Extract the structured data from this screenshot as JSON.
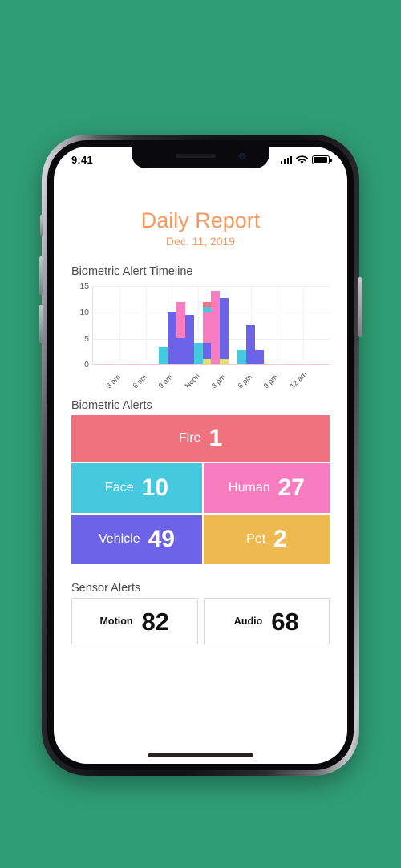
{
  "status_bar": {
    "time": "9:41",
    "signal_icon": "cellular-signal-icon",
    "wifi_icon": "wifi-icon",
    "battery_icon": "battery-icon"
  },
  "header": {
    "title": "Daily Report",
    "date": "Dec. 11, 2019",
    "accent_color": "#f5985e"
  },
  "timeline": {
    "label": "Biometric Alert Timeline"
  },
  "biometric": {
    "label": "Biometric Alerts",
    "tiles": [
      {
        "label": "Fire",
        "value": "1",
        "color": "#f0727f"
      },
      {
        "label": "Face",
        "value": "10",
        "color": "#46c8de"
      },
      {
        "label": "Human",
        "value": "27",
        "color": "#f77cc0"
      },
      {
        "label": "Vehicle",
        "value": "49",
        "color": "#6c63e8"
      },
      {
        "label": "Pet",
        "value": "2",
        "color": "#eeb94e"
      }
    ]
  },
  "sensor": {
    "label": "Sensor Alerts",
    "cards": [
      {
        "label": "Motion",
        "value": "82"
      },
      {
        "label": "Audio",
        "value": "68"
      }
    ]
  },
  "chart_data": {
    "type": "bar",
    "stacked": true,
    "title": "Biometric Alert Timeline",
    "xlabel": "",
    "ylabel": "",
    "ylim": [
      0,
      15
    ],
    "yticks": [
      0,
      5,
      10,
      15
    ],
    "grid": true,
    "legend": "none",
    "series_colors": {
      "Pet": "#e3dd6e",
      "Vehicle": "#6c63e8",
      "Human": "#f77cc0",
      "Face": "#46c8de",
      "Fire": "#f0727f"
    },
    "xtick_labels": [
      "3 am",
      "6 am",
      "9 am",
      "Noon",
      "3 pm",
      "6 pm",
      "9 pm",
      "12 am"
    ],
    "bars": [
      {
        "hour": "8 am",
        "total": 3.2,
        "segments": {
          "Pet": 0,
          "Vehicle": 0,
          "Human": 0,
          "Face": 3.2,
          "Fire": 0
        }
      },
      {
        "hour": "9 am",
        "total": 10.0,
        "segments": {
          "Pet": 0,
          "Vehicle": 10.0,
          "Human": 0,
          "Face": 0,
          "Fire": 0
        }
      },
      {
        "hour": "10 am",
        "total": 11.8,
        "segments": {
          "Pet": 0,
          "Vehicle": 5.0,
          "Human": 6.8,
          "Face": 0,
          "Fire": 0
        }
      },
      {
        "hour": "11 am",
        "total": 9.4,
        "segments": {
          "Pet": 0,
          "Vehicle": 9.4,
          "Human": 0,
          "Face": 0,
          "Fire": 0
        }
      },
      {
        "hour": "Noon",
        "total": 4.1,
        "segments": {
          "Pet": 0,
          "Vehicle": 0,
          "Human": 0,
          "Face": 4.1,
          "Fire": 0
        }
      },
      {
        "hour": "1 pm",
        "total": 11.9,
        "segments": {
          "Pet": 1.0,
          "Vehicle": 3.1,
          "Human": 5.9,
          "Face": 1.0,
          "Fire": 0.9
        }
      },
      {
        "hour": "2 pm",
        "total": 14.0,
        "segments": {
          "Pet": 0,
          "Vehicle": 0,
          "Human": 14.0,
          "Face": 0,
          "Fire": 0
        }
      },
      {
        "hour": "3 pm",
        "total": 12.6,
        "segments": {
          "Pet": 1.0,
          "Vehicle": 11.6,
          "Human": 0,
          "Face": 0,
          "Fire": 0
        }
      },
      {
        "hour": "5 pm",
        "total": 2.7,
        "segments": {
          "Pet": 0,
          "Vehicle": 0,
          "Human": 0,
          "Face": 2.7,
          "Fire": 0
        }
      },
      {
        "hour": "6 pm",
        "total": 7.5,
        "segments": {
          "Pet": 0,
          "Vehicle": 7.5,
          "Human": 0,
          "Face": 0,
          "Fire": 0
        }
      },
      {
        "hour": "7 pm",
        "total": 2.7,
        "segments": {
          "Pet": 0,
          "Vehicle": 2.7,
          "Human": 0,
          "Face": 0,
          "Fire": 0
        }
      }
    ]
  }
}
